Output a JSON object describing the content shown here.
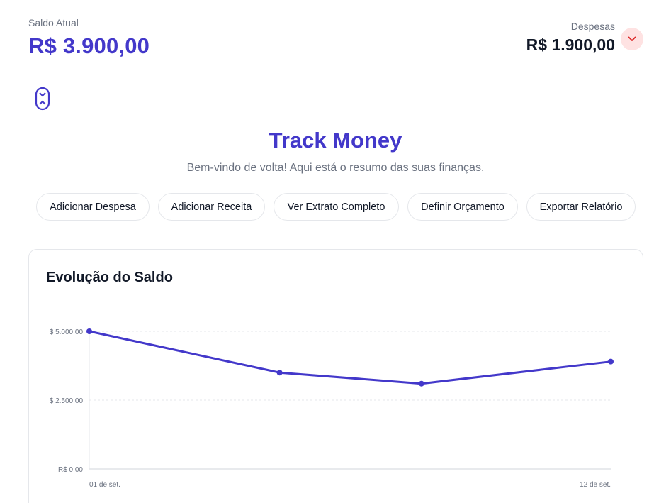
{
  "balance": {
    "label": "Saldo Atual",
    "value": "R$ 3.900,00"
  },
  "expenses": {
    "label": "Despesas",
    "value": "R$ 1.900,00",
    "toggle_icon": "chevron-down-icon"
  },
  "logo": {
    "icon": "wallet-icon"
  },
  "header": {
    "title": "Track Money",
    "subtitle": "Bem-vindo de volta! Aqui está o resumo das suas finanças."
  },
  "actions": [
    {
      "label": "Adicionar Despesa"
    },
    {
      "label": "Adicionar Receita"
    },
    {
      "label": "Ver Extrato Completo"
    },
    {
      "label": "Definir Orçamento"
    },
    {
      "label": "Exportar Relatório"
    }
  ],
  "chart": {
    "title": "Evolução do Saldo"
  },
  "colors": {
    "accent": "#4338ca",
    "expense_bg": "#fee2e2",
    "expense_icon": "#dc2626"
  },
  "chart_data": {
    "type": "line",
    "title": "Evolução do Saldo",
    "x": [
      "01 de set.",
      "",
      "",
      "12 de set."
    ],
    "x_tick_labels": [
      "01 de set.",
      "12 de set."
    ],
    "series": [
      {
        "values": [
          5000,
          3500,
          3100,
          3900
        ]
      }
    ],
    "y_tick_labels": [
      "$ 5.000,00",
      "$ 2.500,00",
      "R$ 0,00"
    ],
    "y_ticks": [
      5000,
      2500,
      0
    ],
    "ylim": [
      0,
      5000
    ],
    "grid": true,
    "xlabel": "",
    "ylabel": ""
  }
}
